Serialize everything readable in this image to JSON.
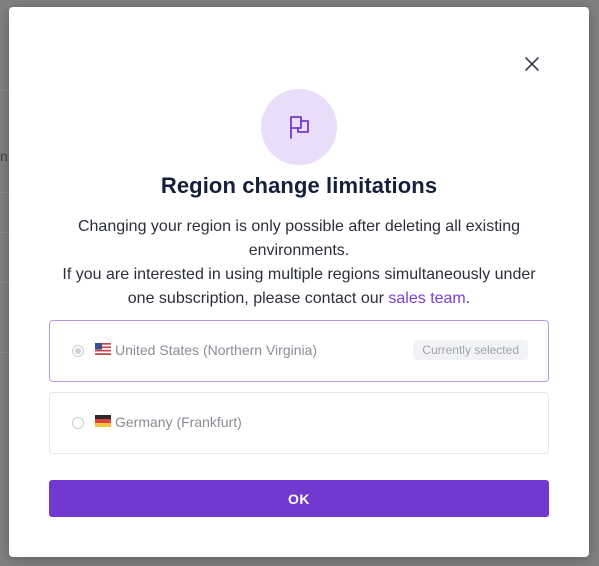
{
  "background": {
    "fragment_text": "n"
  },
  "modal": {
    "close_icon": "close-icon",
    "header_icon": "flag-icon",
    "title": "Region change limitations",
    "description_line1": "Changing your region is only possible after deleting all existing environments.",
    "description_line2_prefix": "If you are interested in using multiple regions simultaneously under one subscription, please contact our ",
    "description_link": "sales team",
    "description_line2_suffix": ".",
    "regions": [
      {
        "flag": "us-flag",
        "label": "United States (Northern Virginia)",
        "selected": true,
        "badge": "Currently selected"
      },
      {
        "flag": "de-flag",
        "label": "Germany (Frankfurt)",
        "selected": false
      }
    ],
    "ok_label": "OK"
  },
  "colors": {
    "accent": "#7338d0",
    "link": "#7b3fd4",
    "icon_circle_bg": "#e9ddf9",
    "title": "#14203a",
    "selected_border": "#b99ae6"
  }
}
